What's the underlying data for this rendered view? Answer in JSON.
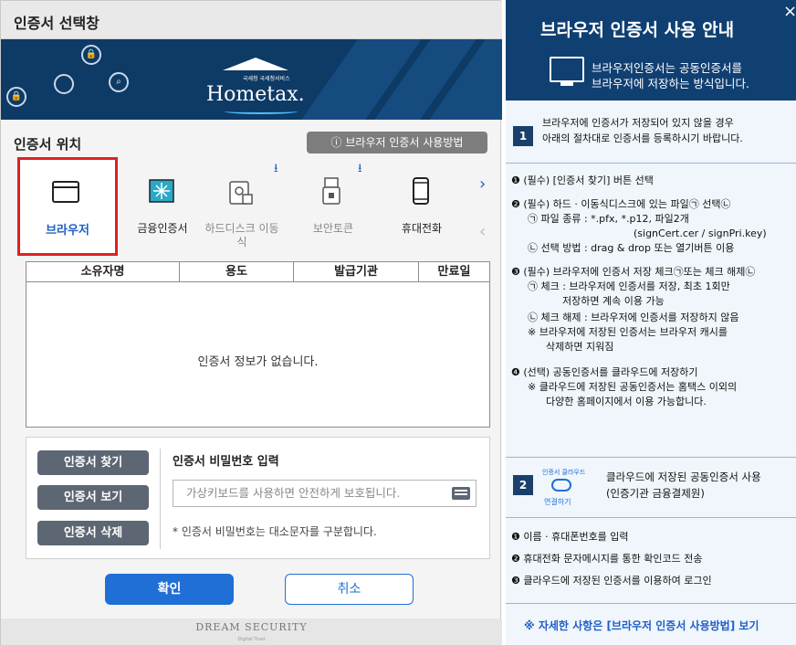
{
  "dialog": {
    "title": "인증서 선택창",
    "logo_small": "국세청 국세청서비스",
    "logo_text": "Hometax.",
    "location_label": "인증서 위치",
    "howto_button": "ⓘ 브라우저 인증서 사용방법",
    "storage": [
      {
        "label": "브라우저",
        "icon": "browser-window-icon",
        "selected": true
      },
      {
        "label": "금융인증서",
        "icon": "financial-cert-icon"
      },
      {
        "label": "하드디스크 이동식",
        "icon": "hdd-usb-icon"
      },
      {
        "label": "보안토큰",
        "icon": "security-token-icon"
      },
      {
        "label": "휴대전화",
        "icon": "mobile-phone-icon"
      }
    ],
    "table_headers": [
      "소유자명",
      "용도",
      "발급기관",
      "만료일"
    ],
    "empty_message": "인증서 정보가 없습니다.",
    "buttons": {
      "find": "인증서 찾기",
      "view": "인증서 보기",
      "delete": "인증서 삭제",
      "ok": "확인",
      "cancel": "취소"
    },
    "password_label": "인증서 비밀번호 입력",
    "password_placeholder": "가상키보드를 사용하면 안전하게 보호됩니다.",
    "password_note": "* 인증서 비밀번호는 대소문자를 구분합니다.",
    "footer_brand": "DREAM SECURITY",
    "footer_sub": "Digital Trust"
  },
  "guide": {
    "title": "브라우저 인증서 사용 안내",
    "close": "×",
    "subtitle_line1": "브라우저인증서는 공동인증서를",
    "subtitle_line2": "브라우저에 저장하는 방식입니다.",
    "step1_num": "1",
    "step1_line1": "브라우저에 인증서가 저장되어 있지 않을 경우",
    "step1_line2": "아래의 절차대로 인증서를 등록하시기 바랍니다.",
    "s1_items": [
      "❶ (필수) [인증서 찾기] 버튼 선택",
      "❷ (필수) 하드 · 이동식디스크에 있는 파일㉠ 선택㉡",
      "㉠ 파일 종류 : *.pfx, *.p12, 파일2개",
      "(signCert.cer / signPri.key)",
      "㉡ 선택 방법 : drag & drop 또는 열기버튼 이용",
      "❸ (필수) 브라우저에 인증서 저장 체크㉠또는 체크 해제㉡",
      "㉠ 체크 : 브라우저에 인증서를 저장, 최초 1회만",
      "저장하면 계속 이용 가능",
      "㉡ 체크 해제 : 브라우저에 인증서를 저장하지 않음",
      "※ 브라우저에 저장된 인증서는 브라우저 캐시를",
      "삭제하면 지워짐",
      "❹ (선택) 공동인증서를 클라우드에 저장하기",
      "※ 클라우드에 저장된 공동인증서는 홈택스 이외의",
      "다양한 홈페이지에서 이용 가능합니다."
    ],
    "step2_num": "2",
    "cloud_label": "인증서 클라우드",
    "cloud_link": "연결하기",
    "step2_line1": "클라우드에 저장된 공동인증서 사용",
    "step2_line2": "(인증기관 금융결제원)",
    "s2_items": [
      "❶ 이름 · 휴대폰번호를 입력",
      "❷ 휴대전화 문자메시지를 통한 확인코드 전송",
      "❸ 클라우드에 저장된 인증서를 이용하여 로그인"
    ],
    "more_link": "※ 자세한 사항은 [브라우저 인증서 사용방법] 보기"
  }
}
